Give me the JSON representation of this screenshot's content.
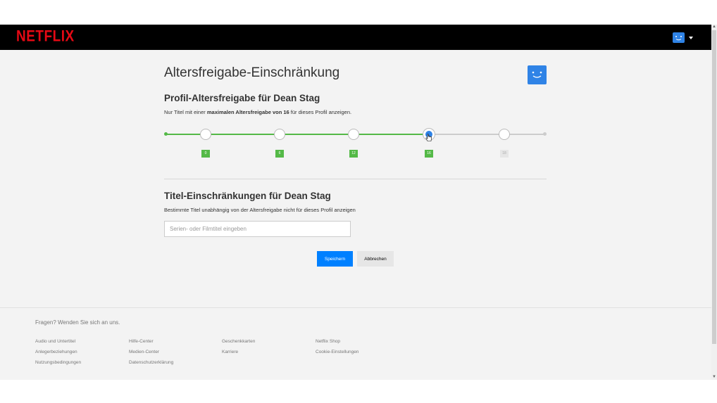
{
  "header": {
    "logo": "NETFLIX"
  },
  "page": {
    "title": "Altersfreigabe-Einschränkung"
  },
  "rating": {
    "title": "Profil-Altersfreigabe für Dean Stag",
    "desc_pre": "Nur Titel mit einer ",
    "desc_bold": "maximalen Altersfreigabe von 16",
    "desc_post": " für dieses Profil anzeigen.",
    "levels": [
      "0",
      "6",
      "12",
      "16",
      "18"
    ],
    "selected": "16"
  },
  "restrictions": {
    "title": "Titel-Einschränkungen für Dean Stag",
    "desc": "Bestimmte Titel unabhängig von der Altersfreigabe nicht für dieses Profil anzeigen",
    "placeholder": "Serien- oder Filmtitel eingeben"
  },
  "actions": {
    "save": "Speichern",
    "cancel": "Abbrechen"
  },
  "footer": {
    "question": "Fragen? Wenden Sie sich an uns.",
    "links": [
      "Audio und Untertitel",
      "Hilfe-Center",
      "Geschenkkarten",
      "Netflix Shop",
      "Anlegerbeziehungen",
      "Medien-Center",
      "Karriere",
      "Cookie-Einstellungen",
      "Nutzungsbedingungen",
      "Datenschutzerklärung"
    ]
  },
  "colors": {
    "brand": "#e50914",
    "accent": "#0080ff",
    "slider_active": "#54b947",
    "avatar": "#2f83e6"
  },
  "icons": {
    "profile": "smiley-avatar-icon",
    "menu": "caret-down-icon",
    "cursor": "hand-pointer-icon"
  }
}
